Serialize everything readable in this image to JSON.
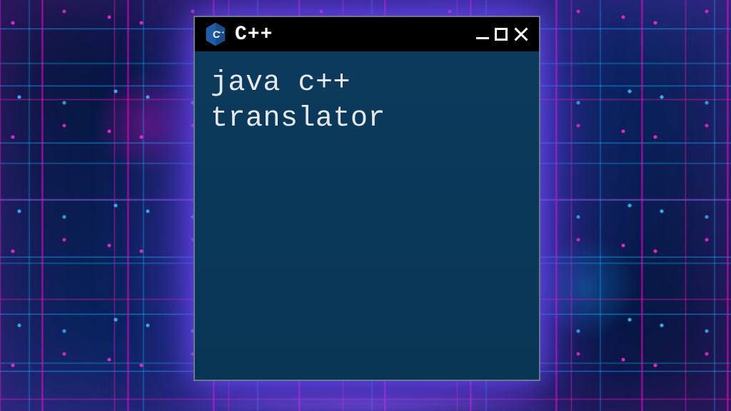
{
  "window": {
    "title": "C++",
    "icon_name": "cpp-logo-icon",
    "content_text": "java c++\ntranslator"
  },
  "controls": {
    "minimize_label": "Minimize",
    "maximize_label": "Maximize",
    "close_label": "Close"
  },
  "colors": {
    "window_bg": "#0b3a5c",
    "titlebar_bg": "#000000",
    "text": "#e8e8e8",
    "accent_cpp_blue": "#1e5ea8",
    "neon_magenta": "#ff14c8",
    "neon_cyan": "#28c8ff"
  }
}
